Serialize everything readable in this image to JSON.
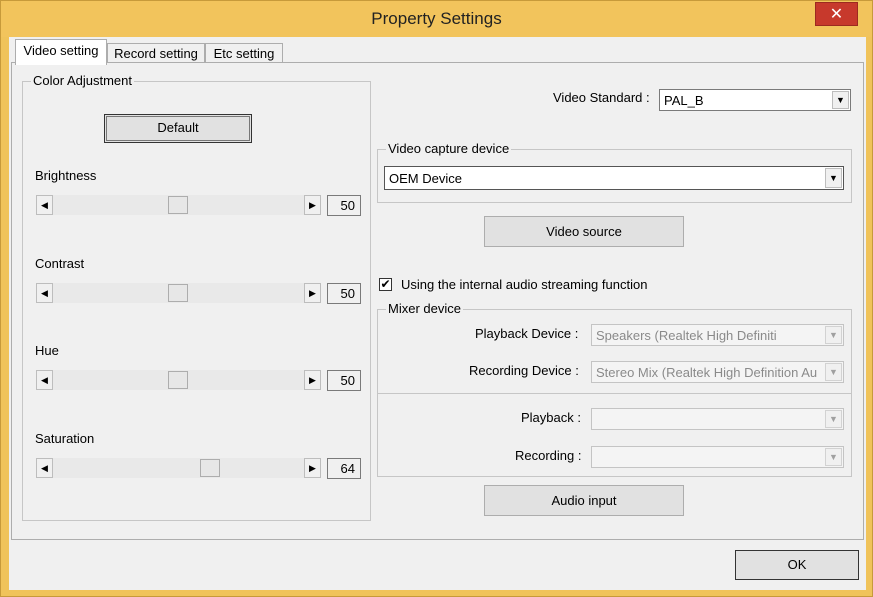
{
  "window": {
    "title": "Property Settings",
    "close_glyph": "✕"
  },
  "tabs": [
    {
      "label": "Video setting",
      "active": true
    },
    {
      "label": "Record setting",
      "active": false
    },
    {
      "label": "Etc setting",
      "active": false
    }
  ],
  "color_adjustment": {
    "group_label": "Color Adjustment",
    "default_button": "Default",
    "sliders": [
      {
        "label": "Brightness",
        "value": "50",
        "position": 0.5
      },
      {
        "label": "Contrast",
        "value": "50",
        "position": 0.5
      },
      {
        "label": "Hue",
        "value": "50",
        "position": 0.5
      },
      {
        "label": "Saturation",
        "value": "64",
        "position": 0.64
      }
    ],
    "left_arrow": "◀",
    "right_arrow": "▶"
  },
  "video": {
    "standard_label": "Video Standard :",
    "standard_value": "PAL_B",
    "capture_group_label": "Video capture device",
    "capture_device": "OEM Device",
    "video_source_button": "Video source",
    "dropdown_glyph": "▼"
  },
  "audio": {
    "internal_streaming_label": "Using the internal audio streaming function",
    "internal_streaming_checked": true,
    "check_glyph": "✔",
    "mixer_group_label": "Mixer device",
    "playback_device_label": "Playback Device :",
    "playback_device_value": "Speakers (Realtek High Definiti",
    "recording_device_label": "Recording Device :",
    "recording_device_value": "Stereo Mix (Realtek High Definition Au",
    "playback_label": "Playback :",
    "playback_value": "",
    "recording_label": "Recording :",
    "recording_value": "",
    "audio_input_button": "Audio input"
  },
  "footer": {
    "ok_button": "OK"
  }
}
